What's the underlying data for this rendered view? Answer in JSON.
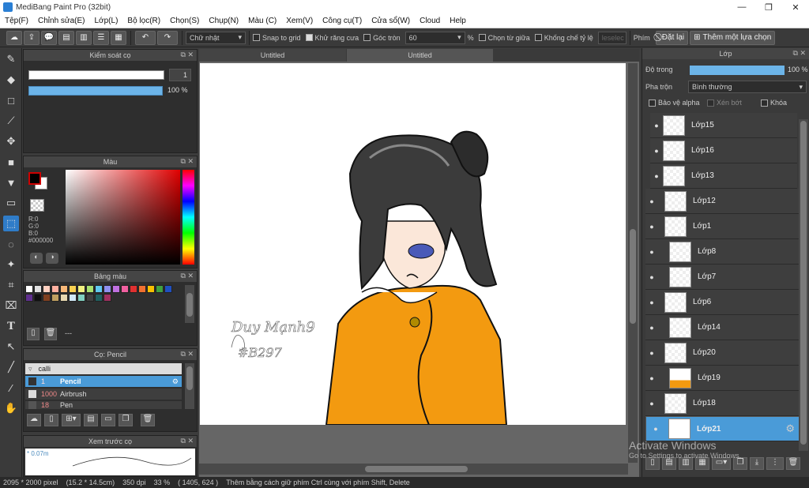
{
  "window": {
    "title": "MediBang Paint Pro (32bit)",
    "minimize": "—",
    "maximize": "❐",
    "close": "✕"
  },
  "menu": [
    "Tệp(F)",
    "Chỉnh sửa(E)",
    "Lớp(L)",
    "Bộ lọc(R)",
    "Chọn(S)",
    "Chụp(N)",
    "Màu (C)",
    "Xem(V)",
    "Công cụ(T)",
    "Cửa sổ(W)",
    "Cloud",
    "Help"
  ],
  "toolbar": {
    "shape_select": "Chữ nhật",
    "snap": "Snap to grid",
    "antialias": "Khử răng cưa",
    "round_corner": "Góc tròn",
    "round_value": "60",
    "percent": "%",
    "from_center": "Chọn từ giữa",
    "fixed_ratio": "Khống chế tỷ lệ",
    "clear_field": "leselec",
    "key_label": "Phím",
    "reset": "Đặt lại",
    "add_option": "Thêm một lựa chọn"
  },
  "brush_control": {
    "title": "Kiểm soát cọ",
    "size": "1",
    "opacity": "100 %"
  },
  "color_panel": {
    "title": "Màu",
    "r": "R:0",
    "g": "G:0",
    "b": "B:0",
    "hex": "#000000"
  },
  "palette": {
    "title": "Bảng màu",
    "dash": "---",
    "colors": [
      "#ffffff",
      "#e0e0e0",
      "#ffd0c0",
      "#ffb0a0",
      "#f8b878",
      "#f8d050",
      "#f0f080",
      "#a8e070",
      "#60c8f0",
      "#9090f0",
      "#c070e0",
      "#f060a0",
      "#e03030",
      "#f07030",
      "#f8c000",
      "#40a040",
      "#2050c0",
      "#603090",
      "#101010",
      "#804020",
      "#c0a060",
      "#e8d8b0",
      "#d0e8f8",
      "#80d0c0",
      "#404040",
      "#206060",
      "#a03060"
    ]
  },
  "brush_list": {
    "title": "Cọ: Pencil",
    "group": "calli",
    "items": [
      {
        "size": "1",
        "name": "Pencil"
      },
      {
        "size": "1000",
        "name": "Airbrush"
      },
      {
        "size": "18",
        "name": "Pen"
      }
    ]
  },
  "preview": {
    "title": "Xem trước cọ",
    "size": "* 0.07m"
  },
  "tabs": [
    "Untitled",
    "Untitled"
  ],
  "signature": {
    "name": "Duy Mạnh9",
    "code": "#B297"
  },
  "layers": {
    "title": "Lớp",
    "opacity_label": "Độ trong",
    "opacity_value": "100 %",
    "blend_label": "Pha trộn",
    "blend_value": "Bình thường",
    "protect_alpha": "Bảo vệ alpha",
    "clip": "Xén bớt",
    "lock": "Khóa",
    "items": [
      {
        "name": "Lớp15"
      },
      {
        "name": "Lớp16"
      },
      {
        "name": "Lớp13"
      },
      {
        "name": "Lớp12"
      },
      {
        "name": "Lớp1"
      },
      {
        "name": "Lớp8"
      },
      {
        "name": "Lớp7"
      },
      {
        "name": "Lớp6"
      },
      {
        "name": "Lớp14"
      },
      {
        "name": "Lớp20"
      },
      {
        "name": "Lớp19"
      },
      {
        "name": "Lớp18"
      },
      {
        "name": "Lớp21"
      }
    ]
  },
  "watermark": {
    "line1": "Activate Windows",
    "line2": "Go to Settings to activate Windows."
  },
  "status": {
    "size": "2095 * 2000 pixel",
    "cm": "(15.2 * 14.5cm)",
    "dpi": "350 dpi",
    "zoom": "33 %",
    "coords": "( 1405, 624 )",
    "hint": "Thêm bằng cách giữ phím Ctrl cùng với phím Shift, Delete"
  }
}
